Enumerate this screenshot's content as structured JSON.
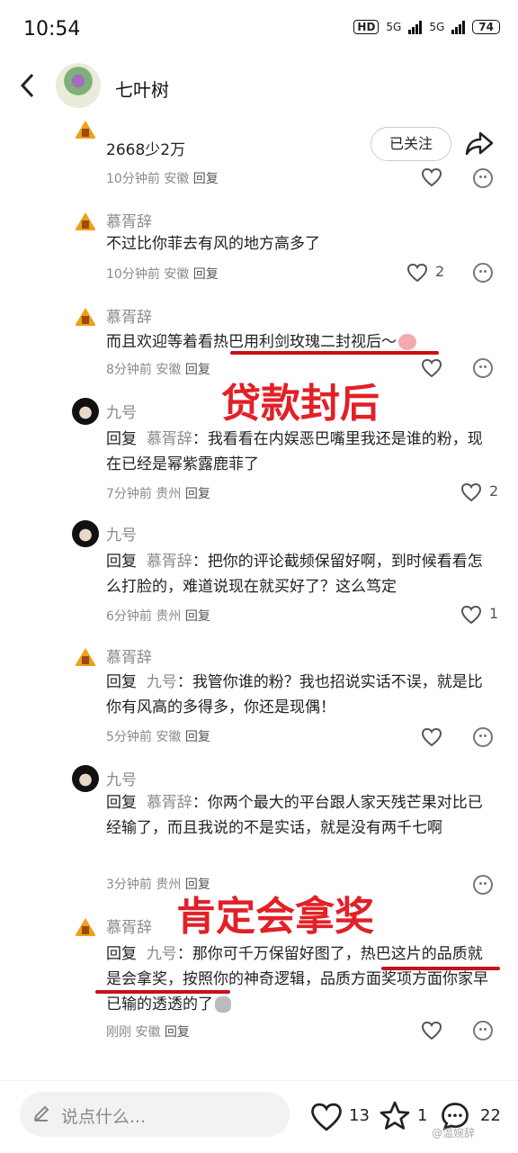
{
  "status": {
    "time": "10:54",
    "hd": "HD",
    "net1": "5G",
    "net2": "5G",
    "battery": "74"
  },
  "header": {
    "title": "七叶树",
    "follow_label": "已关注"
  },
  "comments": [
    {
      "name": "慕胥辞",
      "text": "2668少2万",
      "time": "10分钟前",
      "loc": "安徽",
      "reply": "回复",
      "likes": ""
    },
    {
      "name": "慕胥辞",
      "text": "不过比你菲去有风的地方高多了",
      "time": "10分钟前",
      "loc": "安徽",
      "reply": "回复",
      "likes": "2"
    },
    {
      "name": "慕胥辞",
      "text": "而且欢迎等着看热巴用利剑玫瑰二封视后～",
      "time": "8分钟前",
      "loc": "安徽",
      "reply": "回复",
      "likes": ""
    },
    {
      "name": "九号",
      "reply_to": "慕胥辞",
      "text": "我看看在内娱恶巴嘴里我还是谁的粉，现在已经是幂紫露鹿菲了",
      "time": "7分钟前",
      "loc": "贵州",
      "reply": "回复",
      "likes": "2"
    },
    {
      "name": "九号",
      "reply_to": "慕胥辞",
      "text": "把你的评论截频保留好啊，到时候看看怎么打脸的，难道说现在就买好了？这么笃定",
      "time": "6分钟前",
      "loc": "贵州",
      "reply": "回复",
      "likes": "1"
    },
    {
      "name": "慕胥辞",
      "reply_to": "九号",
      "text": "我管你谁的粉？我也招说实话不误，就是比你有风高的多得多，你还是现偶！",
      "time": "5分钟前",
      "loc": "安徽",
      "reply": "回复",
      "likes": ""
    },
    {
      "name": "九号",
      "reply_to": "慕胥辞",
      "text": "你两个最大的平台跟人家天残芒果对比已经输了，而且我说的不是实话，就是没有两千七啊",
      "time": "3分钟前",
      "loc": "贵州",
      "reply": "回复",
      "likes": ""
    },
    {
      "name": "慕胥辞",
      "reply_to": "九号",
      "text": "那你可千万保留好图了，热巴这片的品质就是会拿奖，按照你的神奇逻辑，品质方面奖项方面你家早已输的透透的了",
      "time": "刚刚",
      "loc": "安徽",
      "reply": "回复",
      "likes": ""
    }
  ],
  "reply_prefix": "回复",
  "annotations": {
    "a1": "贷款封后",
    "a2": "肯定会拿奖"
  },
  "bottom": {
    "placeholder": "说点什么...",
    "likes": "13",
    "stars": "1",
    "comments": "22"
  },
  "watermark": "@温婉辞",
  "colors": {
    "annotation": "#e22027",
    "meta": "#8a8a8a"
  }
}
